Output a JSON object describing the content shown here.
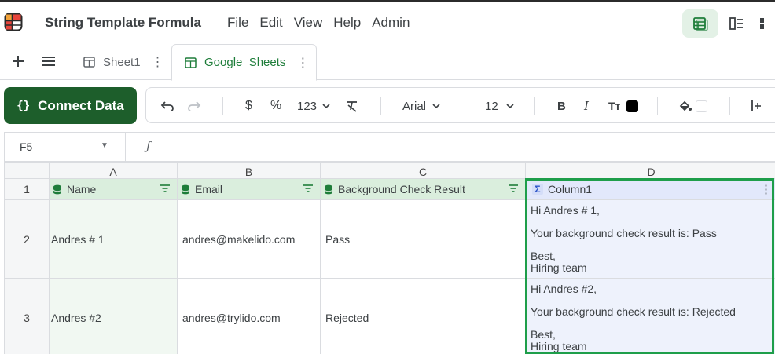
{
  "app": {
    "title": "String Template Formula",
    "menu": [
      "File",
      "Edit",
      "View",
      "Help",
      "Admin"
    ]
  },
  "tabs": [
    {
      "label": "Sheet1",
      "active": false
    },
    {
      "label": "Google_Sheets",
      "active": true
    }
  ],
  "toolbar": {
    "connect_label": "Connect Data",
    "connect_icon": "{}",
    "currency": "$",
    "percent": "%",
    "number_format": "123",
    "font": "Arial",
    "font_size": "12",
    "bold": "B",
    "italic": "I",
    "text_size": "Tт"
  },
  "formula_bar": {
    "cell_ref": "F5",
    "fx": "ƒ"
  },
  "grid": {
    "columns": [
      "A",
      "B",
      "C",
      "D"
    ],
    "row_numbers": [
      "1",
      "2",
      "3"
    ],
    "headers": [
      "Name",
      "Email",
      "Background Check Result",
      "Column1"
    ],
    "rows": [
      {
        "name": "Andres # 1",
        "email": "andres@makelido.com",
        "result": "Pass",
        "template": {
          "greeting": "Hi Andres # 1,",
          "body": "Your background check result is: Pass",
          "closing": "Best,",
          "signature": "Hiring team"
        }
      },
      {
        "name": "Andres #2",
        "email": "andres@trylido.com",
        "result": "Rejected",
        "template": {
          "greeting": "Hi Andres #2,",
          "body": "Your background check result is: Rejected",
          "closing": "Best,",
          "signature": "Hiring team"
        }
      }
    ]
  },
  "colors": {
    "accent_green": "#1d5e2b",
    "highlight_border": "#1e9e4a",
    "field_header_bg": "#daeedd",
    "formula_header_bg": "#e2e8fb"
  }
}
